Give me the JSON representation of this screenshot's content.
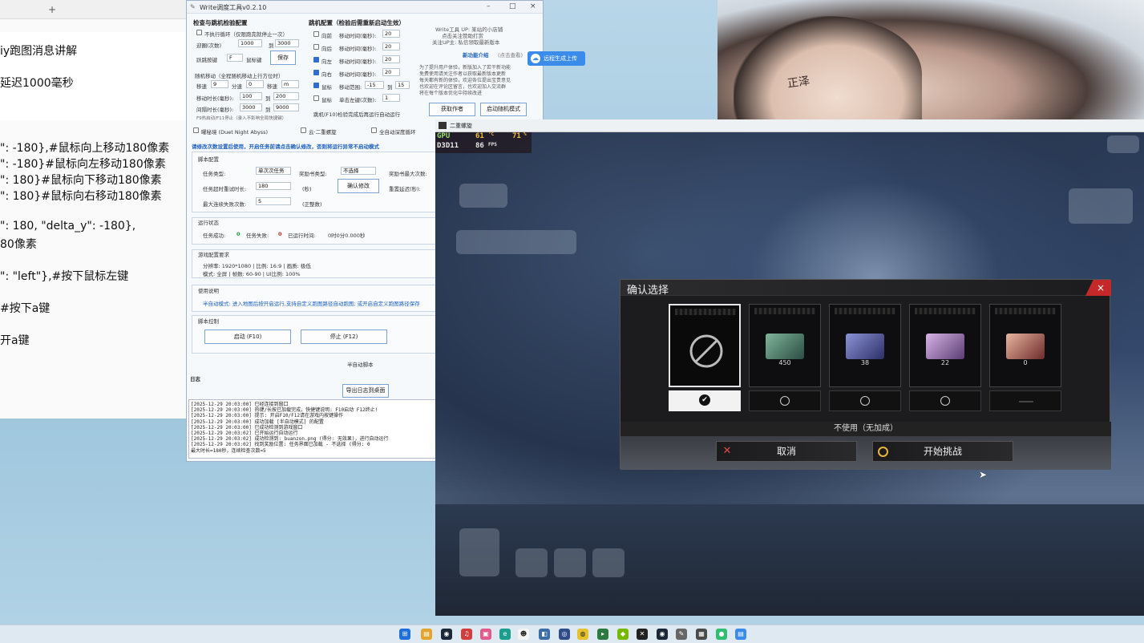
{
  "editor": {
    "lines": [
      "iy跑图消息讲解",
      "延迟1000毫秒",
      "\": -180},#鼠标向上移动180像素",
      "\": -180}#鼠标向左移动180像素",
      "\": 180}#鼠标向下移动180像素",
      "\": 180}#鼠标向右移动180像素",
      "\": 180, \"delta_y\": -180},",
      "80像素",
      "\": \"left\"},#按下鼠标左键",
      "#按下a键",
      "开a键"
    ]
  },
  "tool": {
    "title": "Write调度工具v0.2.10",
    "section_left": "检查与跳机检验配置",
    "no_loop_label": "不执行循环（仅限跑完就停止一次）",
    "loop_count_label": "迎圈(次数)",
    "loop_from": "1000",
    "loop_to_label": "到",
    "loop_to": "3000",
    "key_label": "跃跳按键",
    "key_value": "F",
    "key_hint": "鼠标键",
    "save_btn": "保存",
    "random_title": "随机移动（全程随机移动上行方位时）",
    "x_label": "移速",
    "x_val": "9",
    "y_label": "分速",
    "y_val": "0",
    "z_label": "移速",
    "z_val": "m",
    "interval_label": "移动时长(毫秒):",
    "interval_from": "100",
    "interval_to": "200",
    "gap_label": "间隔时长(毫秒):",
    "gap_from": "3000",
    "gap_to": "9000",
    "hint_small": "F9热启动/F11停止（录入不影响全局快捷键）",
    "section_right": "跳机配置（检验后需重新启动生效）",
    "moves": [
      {
        "label": "向前",
        "unit": "移动时间(毫秒):",
        "value": "20",
        "on": false
      },
      {
        "label": "向后",
        "unit": "移动时间(毫秒):",
        "value": "20",
        "on": false
      },
      {
        "label": "向左",
        "unit": "移动时间(毫秒):",
        "value": "20",
        "on": true
      },
      {
        "label": "向右",
        "unit": "移动时间(毫秒):",
        "value": "20",
        "on": true
      },
      {
        "label": "鼠标",
        "unit": "移动范围:",
        "value": "-15",
        "value2": "15",
        "on": true
      },
      {
        "label": "鼠标",
        "unit": "单击左键(次数):",
        "value": "1",
        "on": false
      }
    ],
    "right_hint": "跳机(F10)检验完成后再运行自动运行",
    "ad_lines": [
      "Write工具 UP: 某站的小店铺",
      "点击关注赞助打赏",
      "关注UP主: 私信领取最新版本"
    ],
    "feature_title": "新功能介绍",
    "feature_sub": "(点击查看)",
    "feature_desc": [
      "为了提升用户体验，新版加入了若干新功能",
      "免费使用请关注作者以获取最新版本更新",
      "每天都有新的体验，欢迎各位提出宝贵意见",
      "也欢迎在评论区留言，也欢迎加入交流群",
      "将在每个版本优化中持续改进"
    ],
    "btn_tutorial": "获取作者",
    "btn_auto": "启动随机模式",
    "float_btn": "远程生成上传",
    "abyss_label": "曜秘境 (Duet Night Abyss)",
    "opt2_label": "云·二重螺旋",
    "opt3_label": "全自动深度循环",
    "blue_notice": "请修改次数设置后使用，开启任务前请点击确认修改，否则将运行异常不启动模式",
    "script_config": "脚本配置",
    "task_type_label": "任务类型:",
    "task_type_val": "单次次任务",
    "scroll_type_label": "奖励书类型:",
    "scroll_type_val": "不选择",
    "max_times_label": "奖励书最大次数:",
    "timeout_label": "任务超时重试时长:",
    "timeout_val": "180",
    "timeout_unit": "(秒)",
    "confirm_btn": "确认修改",
    "retry_delay_label": "重置延迟(秒):",
    "max_fail_label": "最大连续失败次数:",
    "max_fail_val": "5",
    "max_fail_unit": "(正整数)",
    "status_title": "运行状态",
    "success_label": "任务成功:",
    "success_val": "0",
    "fail_label": "任务失败:",
    "fail_val": "0",
    "elapsed_label": "已运行时间:",
    "elapsed_val": "0时0分0.000秒",
    "game_cfg_title": "游戏配置要求",
    "game_cfg_1": "分辨率: 1920*1080 | 比例: 16:9 | 画质: 极低",
    "game_cfg_2": "模式: 全屏 | 帧数: 60-90 | UI比例: 100%",
    "usage_title": "使用说明",
    "usage_text": "半自动模式: 进入地图后按开启运行,支持自定义跑图路径自动跑图; 或开启自定义跑图路径保存",
    "control_title": "脚本控制",
    "start_btn": "启动 (F10)",
    "stop_btn": "停止 (F12)",
    "semi_auto": "半自动脚本",
    "log_title": "日志",
    "export_btn": "导出日志到桌面",
    "log_lines": [
      "[2025-12-29 20:03:00] 已经连接到窗口",
      "[2025-12-29 20:03:00] 热键/长按已加载完成，快捷键说明: F10启动  F12终止!",
      "[2025-12-29 20:03:00] 提示: 开启F10/F12请在游戏内按键操作",
      "[2025-12-29 20:03:00] 成功加载 [半自动模式] 的配置",
      "[2025-12-29 20:03:00] 已成功检测到游戏窗口",
      "[2025-12-29 20:03:02] 已开始运行自动运行",
      "[2025-12-29 20:03:02] 成功检测到: buanzon.png (得分: 无效果)，进行自动运行",
      "[2025-12-29 20:03:02] 找到奖励位置: 任务界面已加载 - 不选择 (得分: 0",
      "最大时长=180秒，连续检查次数=5"
    ]
  },
  "game": {
    "title": "二重螺旋",
    "osd_gpu": "GPU",
    "osd_gpu_val": "61",
    "osd_gpu_unit": "°C",
    "osd_load": "71",
    "osd_load_unit": "%",
    "osd_d3d": "D3D11",
    "osd_fps": "86",
    "osd_fps_unit": "FPS"
  },
  "dialog": {
    "title": "确认选择",
    "close_icon": "×",
    "cards": [
      {
        "count": "",
        "selected": true,
        "color": "#111111"
      },
      {
        "count": "450",
        "selected": false,
        "color": "#4e7a6b"
      },
      {
        "count": "38",
        "selected": false,
        "color": "#4b4f86"
      },
      {
        "count": "22",
        "selected": false,
        "color": "#8a6ea0"
      },
      {
        "count": "0",
        "selected": false,
        "color": "#a3584e"
      }
    ],
    "no_bonus": "不使用（无加成）",
    "cancel": "取消",
    "start": "开始挑战"
  },
  "colors": {
    "accent_blue": "#1d5fbf",
    "dialog_close": "#c52828"
  }
}
